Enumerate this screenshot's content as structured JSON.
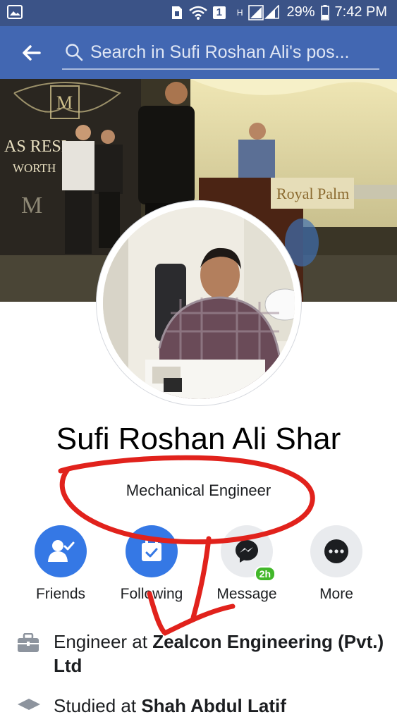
{
  "status_bar": {
    "data_indicator": "1",
    "network_label": "H",
    "battery": "29%",
    "time": "7:42 PM"
  },
  "appbar": {
    "search_placeholder": "Search in Sufi Roshan Ali's pos..."
  },
  "profile": {
    "name": "Sufi Roshan Ali Shar",
    "bio": "Mechanical Engineer"
  },
  "actions": [
    {
      "label": "Friends"
    },
    {
      "label": "Following"
    },
    {
      "label": "Message",
      "badge": "2h"
    },
    {
      "label": "More"
    }
  ],
  "info": {
    "work_prefix": "Engineer at ",
    "work_org": "Zealcon Engineering (Pvt.) Ltd",
    "study_prefix": "Studied at ",
    "study_org": "Shah Abdul Latif"
  },
  "cover_text": {
    "sign_left_1": "AS RESI",
    "sign_left_2": "WORTH",
    "podium": "Royal Palm"
  },
  "colors": {
    "status_bar": "#3b5387",
    "app_bar": "#4267b2",
    "action_blue": "#3578e5",
    "badge_green": "#42b72a",
    "annotation_red": "#e1221c"
  }
}
